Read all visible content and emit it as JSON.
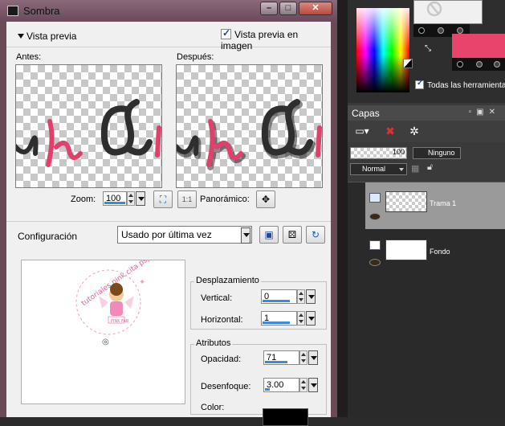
{
  "dialog": {
    "title": "Sombra",
    "vista_previa": "Vista previa",
    "vista_previa_imagen": "Vista previa en imagen",
    "antes": "Antes:",
    "despues": "Después:",
    "zoom_label": "Zoom:",
    "zoom_value": "100",
    "panoramico": "Panorámico:",
    "configuracion_label": "Configuración",
    "configuracion_value": "Usado por última vez",
    "desplazamiento": {
      "title": "Desplazamiento",
      "vertical_label": "Vertical:",
      "vertical_value": "0",
      "horizontal_label": "Horizontal:",
      "horizontal_value": "1"
    },
    "atributos": {
      "title": "Atributos",
      "opacidad_label": "Opacidad:",
      "opacidad_value": "71",
      "desenfoque_label": "Desenfoque:",
      "desenfoque_value": "3.00",
      "color_label": "Color:",
      "color": "#000000"
    },
    "watermark_text": "tutoriales pink cita psp",
    "watermark_badge": "PINK FAB"
  },
  "materials": {
    "todas_herramientas": "Todas las herramientas",
    "foreground": "#f0f0f0",
    "background": "#e8446c"
  },
  "layers": {
    "title": "Capas",
    "opacity": "100",
    "mask": "Ninguno",
    "blend": "Normal",
    "items": [
      {
        "name": "Trama 1",
        "selected": true
      },
      {
        "name": "Fondo",
        "selected": false
      }
    ]
  }
}
